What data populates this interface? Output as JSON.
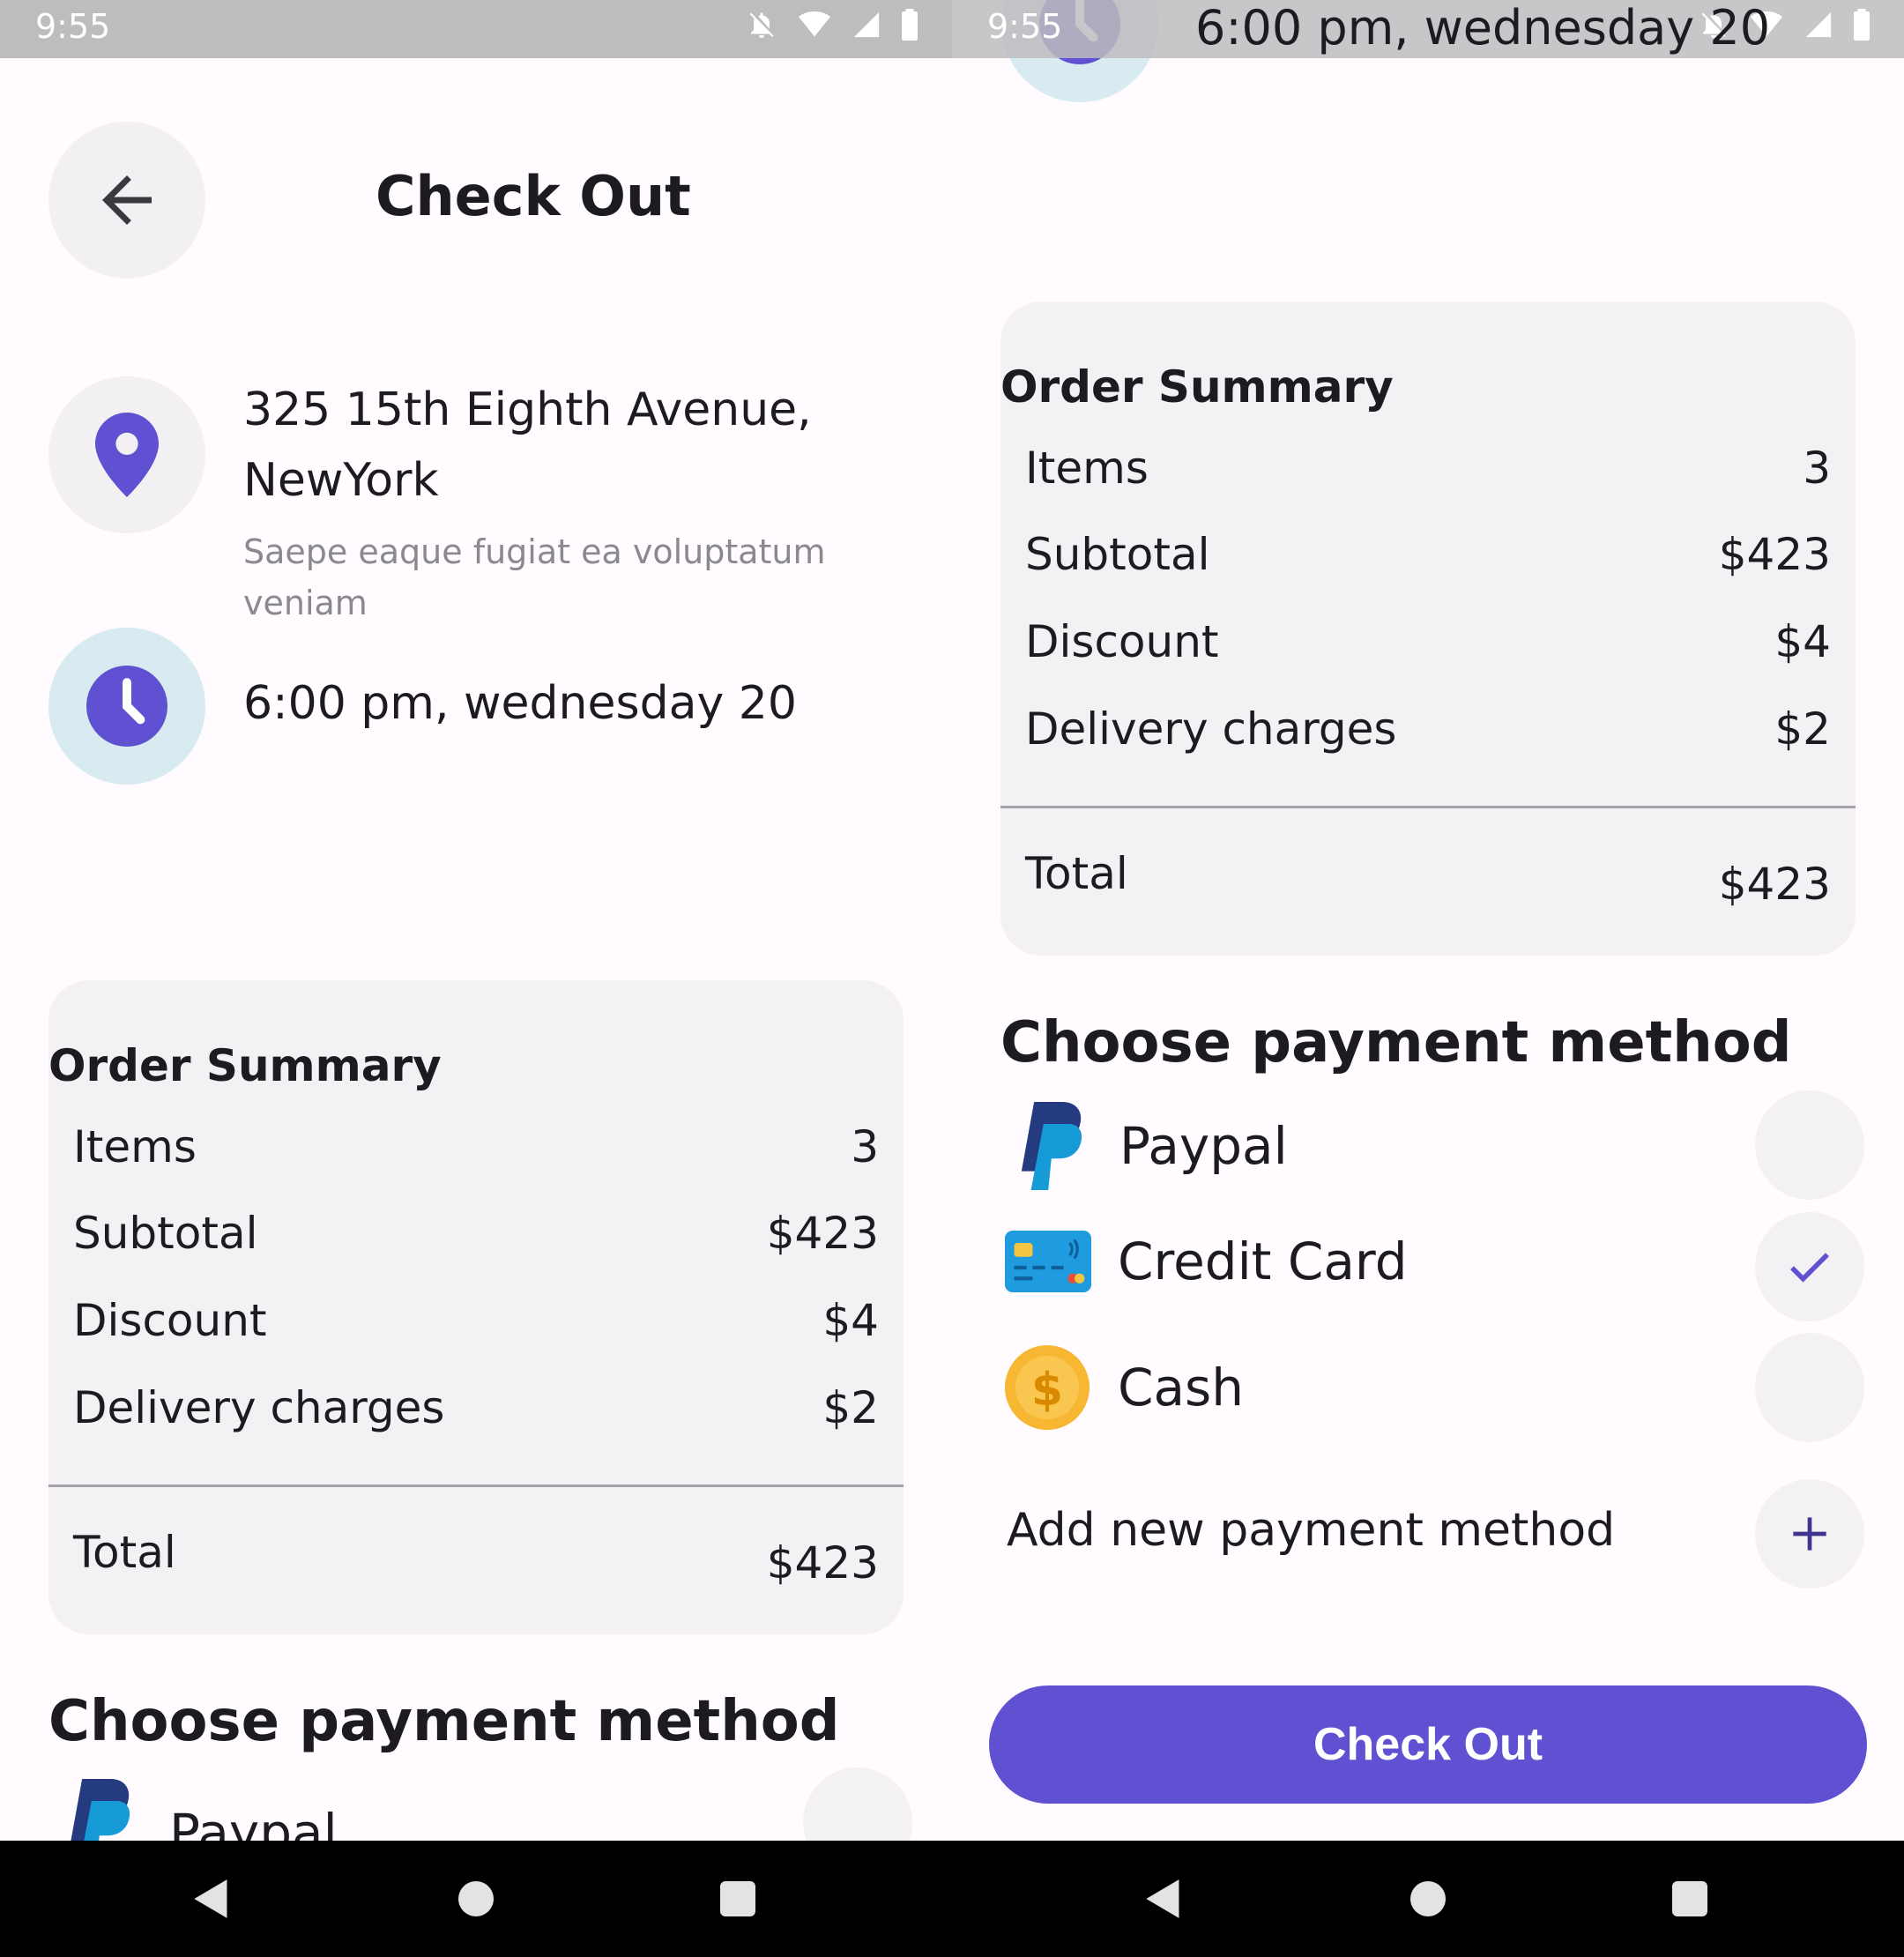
{
  "status": {
    "time": "9:55"
  },
  "header": {
    "title": "Check Out"
  },
  "address": {
    "line1": "325 15th Eighth Avenue,",
    "line2": "NewYork",
    "note": "Saepe eaque fugiat ea voluptatum veniam"
  },
  "delivery": {
    "time": "6:00 pm, wednesday 20"
  },
  "summary": {
    "title": "Order Summary",
    "rows": [
      {
        "label": "Items",
        "value": "3"
      },
      {
        "label": "Subtotal",
        "value": "$423"
      },
      {
        "label": "Discount",
        "value": "$4"
      },
      {
        "label": "Delivery charges",
        "value": "$2"
      }
    ],
    "total_label": "Total",
    "total_value": "$423"
  },
  "payment": {
    "title": "Choose payment method",
    "methods": [
      {
        "label": "Paypal",
        "icon": "paypal-icon",
        "selected": false
      },
      {
        "label": "Credit Card",
        "icon": "credit-card-icon",
        "selected": true
      },
      {
        "label": "Cash",
        "icon": "cash-coin-icon",
        "selected": false
      }
    ],
    "add_label": "Add new payment method"
  },
  "checkout_button": {
    "label": "Check Out"
  },
  "colors": {
    "accent": "#5f51d2",
    "card_bg": "#f3f1f3",
    "clock_halo": "#d7ebf0"
  }
}
